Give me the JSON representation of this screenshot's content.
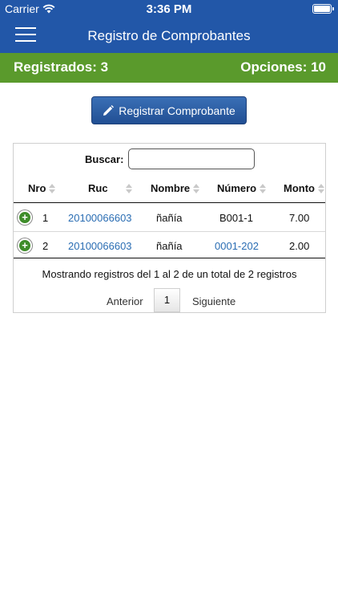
{
  "status_bar": {
    "carrier": "Carrier",
    "time": "3:36 PM"
  },
  "navbar": {
    "title": "Registro de Comprobantes"
  },
  "summary": {
    "registered": "Registrados: 3",
    "options": "Opciones: 10"
  },
  "register_button": {
    "label": "Registrar Comprobante"
  },
  "search": {
    "label": "Buscar:",
    "value": "",
    "placeholder": ""
  },
  "table": {
    "columns": [
      "Nro",
      "Ruc",
      "Nombre",
      "Número",
      "Monto"
    ],
    "rows": [
      {
        "nro": "1",
        "ruc": "20100066603",
        "nombre": "ñañía",
        "numero": "B001-1",
        "monto": "7.00"
      },
      {
        "nro": "2",
        "ruc": "20100066603",
        "nombre": "ñañía",
        "numero": "0001-202",
        "monto": "2.00"
      }
    ],
    "info": "Mostrando registros del 1 al 2 de un total de 2 registros"
  },
  "pagination": {
    "previous": "Anterior",
    "current_page": "1",
    "next": "Siguiente"
  },
  "colors": {
    "navbar": "#2257a8",
    "summary_bar": "#5a9a2c",
    "link": "#2a6db3"
  }
}
